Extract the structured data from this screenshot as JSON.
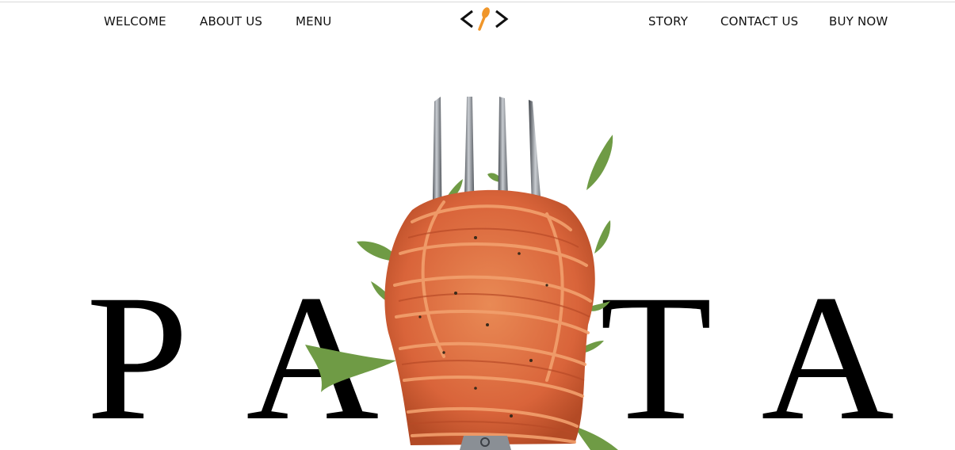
{
  "nav": {
    "left": [
      {
        "label": "WELCOME"
      },
      {
        "label": "ABOUT US"
      },
      {
        "label": "MENU"
      }
    ],
    "right": [
      {
        "label": "STORY"
      },
      {
        "label": "CONTACT US"
      },
      {
        "label": "BUY NOW"
      }
    ],
    "logo_icon": "code-brackets-spoon-icon"
  },
  "hero": {
    "letters": [
      "P",
      "A",
      "T",
      "A"
    ],
    "image_icon": "fork-with-spaghetti-icon"
  },
  "colors": {
    "accent": "#f0962a",
    "text": "#111111",
    "sauce": "#d9643a",
    "arugula": "#6f9b45",
    "fork": "#7d8288"
  }
}
